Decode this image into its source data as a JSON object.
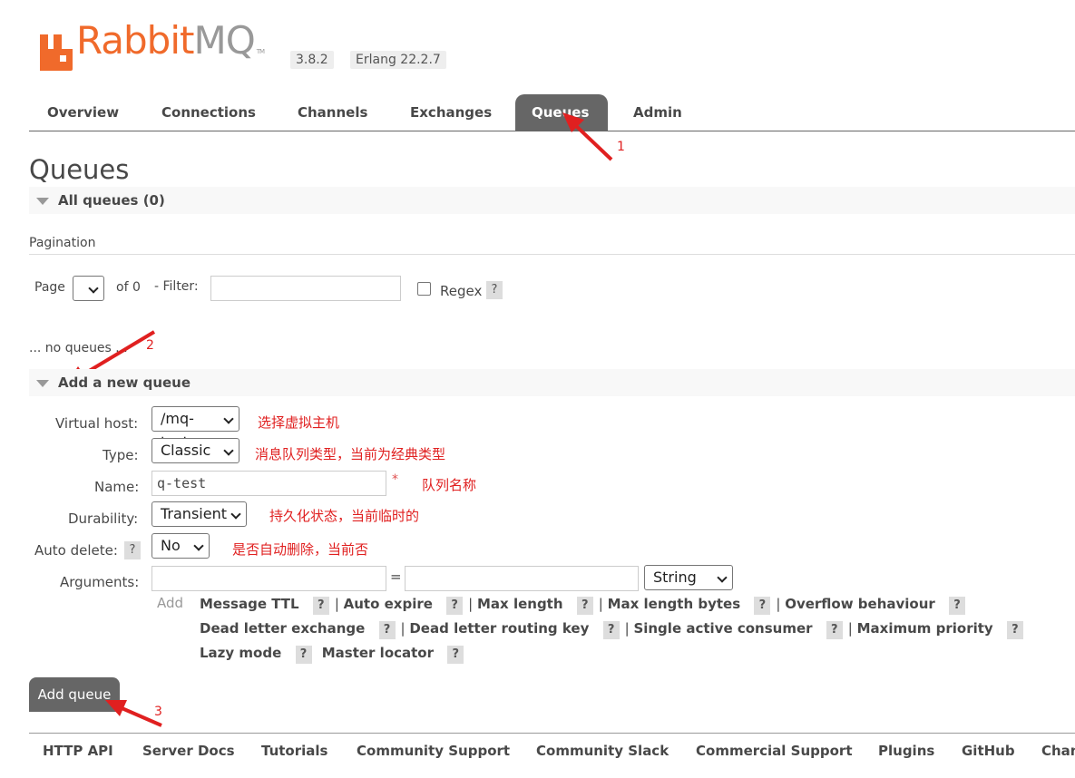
{
  "brand": {
    "name_part1": "Rabbit",
    "name_part2": "MQ",
    "tm": "TM",
    "version": "3.8.2",
    "erlang": "Erlang 22.2.7"
  },
  "tabs": [
    "Overview",
    "Connections",
    "Channels",
    "Exchanges",
    "Queues",
    "Admin"
  ],
  "page_title": "Queues",
  "all_queues": "All queues (0)",
  "pagination": {
    "label": "Pagination",
    "page_label": "Page",
    "of_label": "of 0",
    "filter_label": "- Filter:",
    "filter_value": "",
    "regex_label": "Regex",
    "help": "?"
  },
  "empty_text": "... no queues ...",
  "add_section": "Add a new queue",
  "form": {
    "vhost_label": "Virtual host:",
    "vhost_value": "/mq-test",
    "type_label": "Type:",
    "type_value": "Classic",
    "name_label": "Name:",
    "name_value": "q-test",
    "required_mark": "*",
    "durability_label": "Durability:",
    "durability_value": "Transient",
    "autodelete_label": "Auto delete:",
    "autodelete_value": "No",
    "arguments_label": "Arguments:",
    "eq": "=",
    "arg_type_value": "String",
    "add_label": "Add"
  },
  "arguments": {
    "row1": [
      "Message TTL",
      "Auto expire",
      "Max length",
      "Max length bytes",
      "Overflow behaviour"
    ],
    "row2": [
      "Dead letter exchange",
      "Dead letter routing key",
      "Single active consumer",
      "Maximum priority"
    ],
    "row3": [
      "Lazy mode",
      "Master locator"
    ]
  },
  "annotations": {
    "vhost": "选择虚拟主机",
    "type": "消息队列类型，当前为经典类型",
    "name": "队列名称",
    "durability": "持久化状态，当前临时的",
    "autodelete": "是否自动删除，当前否",
    "n1": "1",
    "n2": "2",
    "n3": "3"
  },
  "add_button": "Add queue",
  "footer": [
    "HTTP API",
    "Server Docs",
    "Tutorials",
    "Community Support",
    "Community Slack",
    "Commercial Support",
    "Plugins",
    "GitHub",
    "Changelog"
  ],
  "colors": {
    "brand": "#f06a2b",
    "tab_active": "#666666",
    "annotation": "#e02020"
  }
}
